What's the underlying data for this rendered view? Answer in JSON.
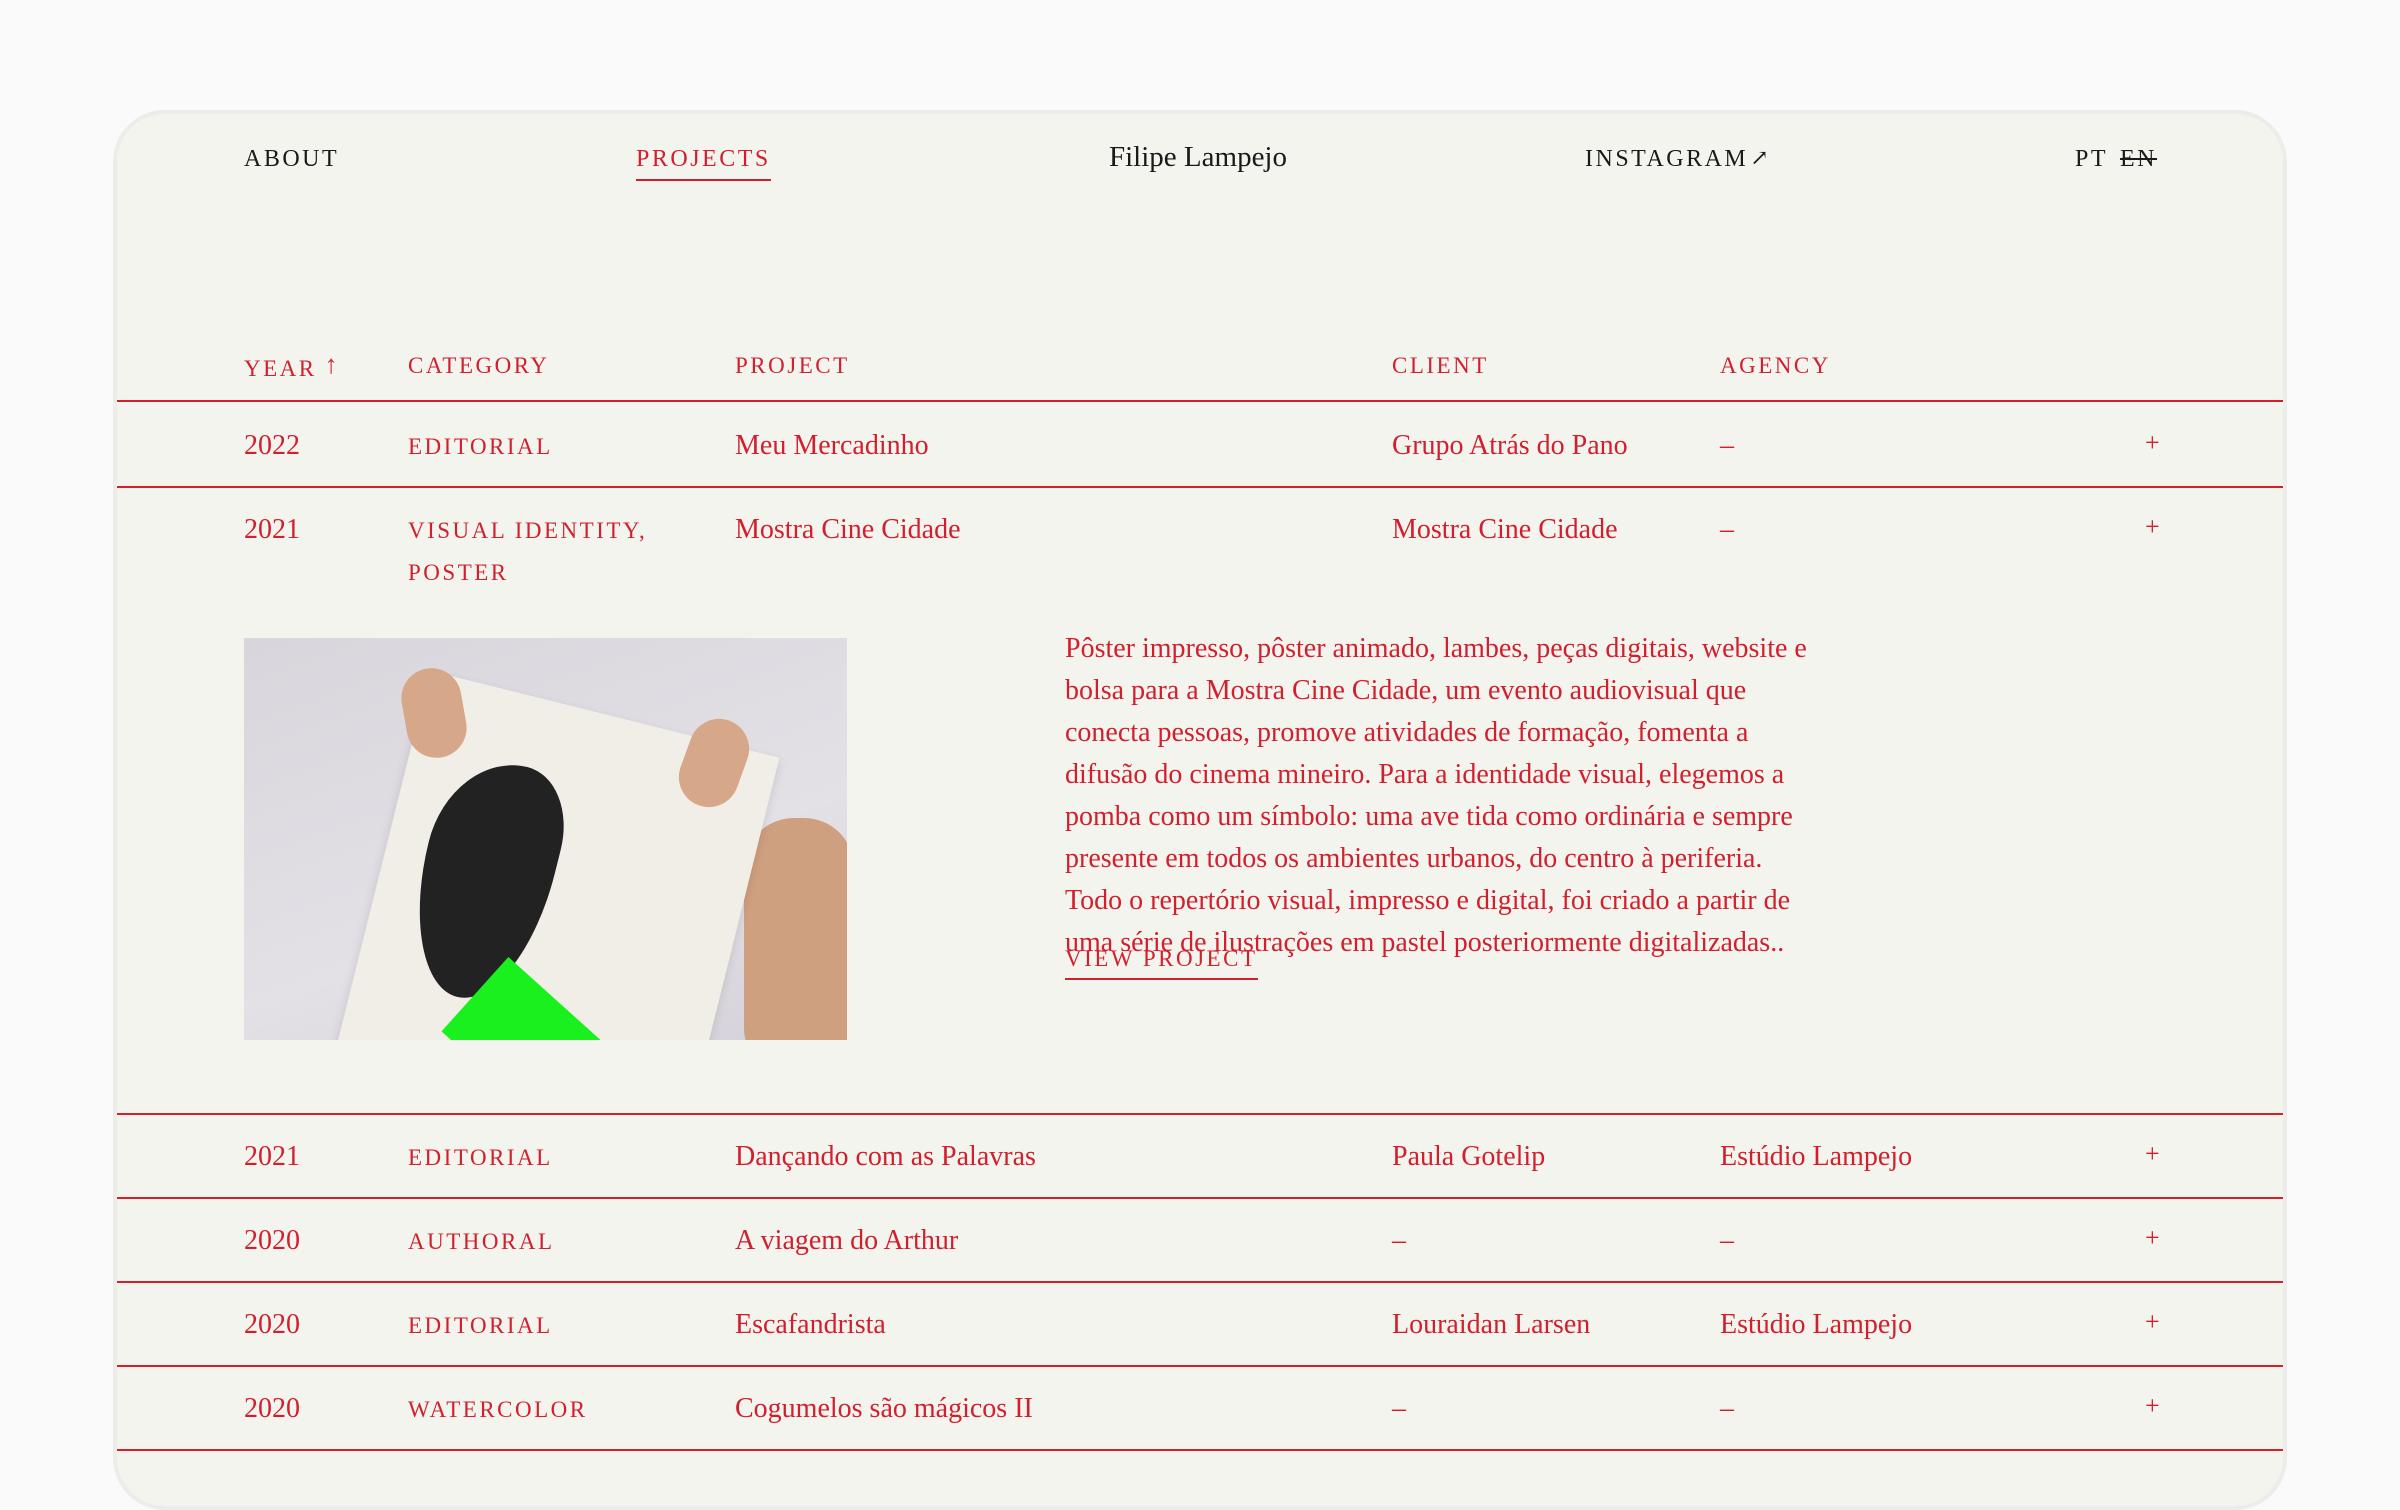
{
  "nav": {
    "about": "About",
    "projects": "Projects",
    "brand": "Filipe Lampejo",
    "instagram": "Instagram",
    "instagram_icon": "↗",
    "lang_pt": "PT",
    "lang_en": "EN"
  },
  "colors": {
    "accent": "#d21f2d",
    "background": "#f4f4ef",
    "text": "#1a1a1a"
  },
  "table": {
    "headers": {
      "year": "Year",
      "sort_icon": "↑",
      "category": "Category",
      "project": "Project",
      "client": "Client",
      "agency": "Agency"
    },
    "rows": [
      {
        "year": "2022",
        "category": "Editorial",
        "project": "Meu Mercadinho",
        "client": "Grupo Atrás do Pano",
        "agency": "–",
        "toggle": "+"
      },
      {
        "year": "2021",
        "category": "Visual Identity,",
        "category2": "Poster",
        "project": "Mostra Cine Cidade",
        "client": "Mostra Cine Cidade",
        "agency": "–",
        "toggle": "+",
        "description": "Pôster impresso, pôster animado, lambes, peças digitais, website e bolsa para a Mostra Cine Cidade, um evento audiovisual que conecta pessoas, promove atividades de formação, fomenta a difusão do cinema mineiro. Para a identidade visual, elegemos a pomba como um símbolo: uma ave tida como ordinária e sempre presente em todos os ambientes urbanos, do centro à periferia. Todo o repertório visual, impresso e digital, foi criado a partir de uma série de ilustrações em pastel posteriormente digitalizadas..",
        "view_link": "View Project"
      },
      {
        "year": "2021",
        "category": "Editorial",
        "project": "Dançando com as Palavras",
        "client": "Paula Gotelip",
        "agency": "Estúdio Lampejo",
        "toggle": "+"
      },
      {
        "year": "2020",
        "category": "Authoral",
        "project": "A viagem do Arthur",
        "client": "–",
        "agency": "–",
        "toggle": "+"
      },
      {
        "year": "2020",
        "category": "Editorial",
        "project": "Escafandrista",
        "client": "Louraidan Larsen",
        "agency": "Estúdio Lampejo",
        "toggle": "+"
      },
      {
        "year": "2020",
        "category": "Watercolor",
        "project": "Cogumelos são mágicos II",
        "client": "–",
        "agency": "–",
        "toggle": "+"
      }
    ]
  }
}
